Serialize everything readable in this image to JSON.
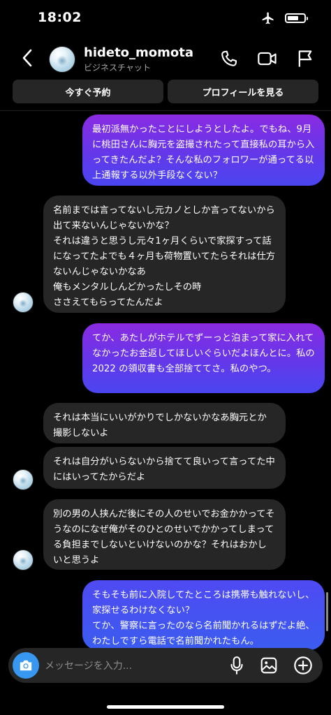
{
  "status_bar": {
    "time": "18:02",
    "battery_level": 0.7
  },
  "header": {
    "username": "hideto_momota",
    "subtitle": "ビジネスチャット"
  },
  "actions": {
    "book_now": "今すぐ予約",
    "view_profile": "プロフィールを見る"
  },
  "messages": [
    {
      "side": "sent",
      "text": "最初派無かったことにしようとしたよ。でもね、9月に桃田さんに胸元を盗撮されたって直接私の耳から入ってきたんだよ？そんな私のフォロワーが通ってる以上通報する以外手段なくない？"
    },
    {
      "side": "received",
      "text": "名前までは言ってないし元カノとしか言ってないから出て来ないんじゃないかな？\nそれは違うと思うし元々1ヶ月くらいで家探すって話になってたよでも４ヶ月も荷物置いてたらそれは仕方ないんじゃないかなあ\n俺もメンタルしんどかったしその時\nささえてもらってたんだよ"
    },
    {
      "side": "sent",
      "text": "てか、あたしがホテルでずーっと泊まって家に入れてなかったお金返してほしいぐらいだよほんとに。私の 2022 の領収書も全部捨ててさ。私のやつ。"
    },
    {
      "side": "received",
      "text": "それは本当にいいがかりでしかないかなあ胸元とか撮影しないよ"
    },
    {
      "side": "received",
      "text": "それは自分がいらないから捨てて良いって言ってた中にはいってたからだよ"
    },
    {
      "side": "received",
      "text": "別の男の人挟んだ後にその人のせいでお金かかってそうなのになぜ俺がそのひとのせいでかかってしまってる負担までしないといけないのかな？それはおかしいと思うよ"
    },
    {
      "side": "sent",
      "text": "そもそも前に入院してたところは携帯も触れないし、家探せるわけなくない？\nてか、警察に言ったのなら名前聞かれるはずだよ絶、わたしですら電話で名前聞かれたもん。"
    }
  ],
  "composer": {
    "placeholder": "メッセージを入力..."
  },
  "colors": {
    "background": "#000000",
    "received_bubble": "#262626",
    "sent_gradient_top": "#8a2be2",
    "sent_gradient_bottom": "#4a45f0",
    "camera_button": "#3897f0"
  }
}
